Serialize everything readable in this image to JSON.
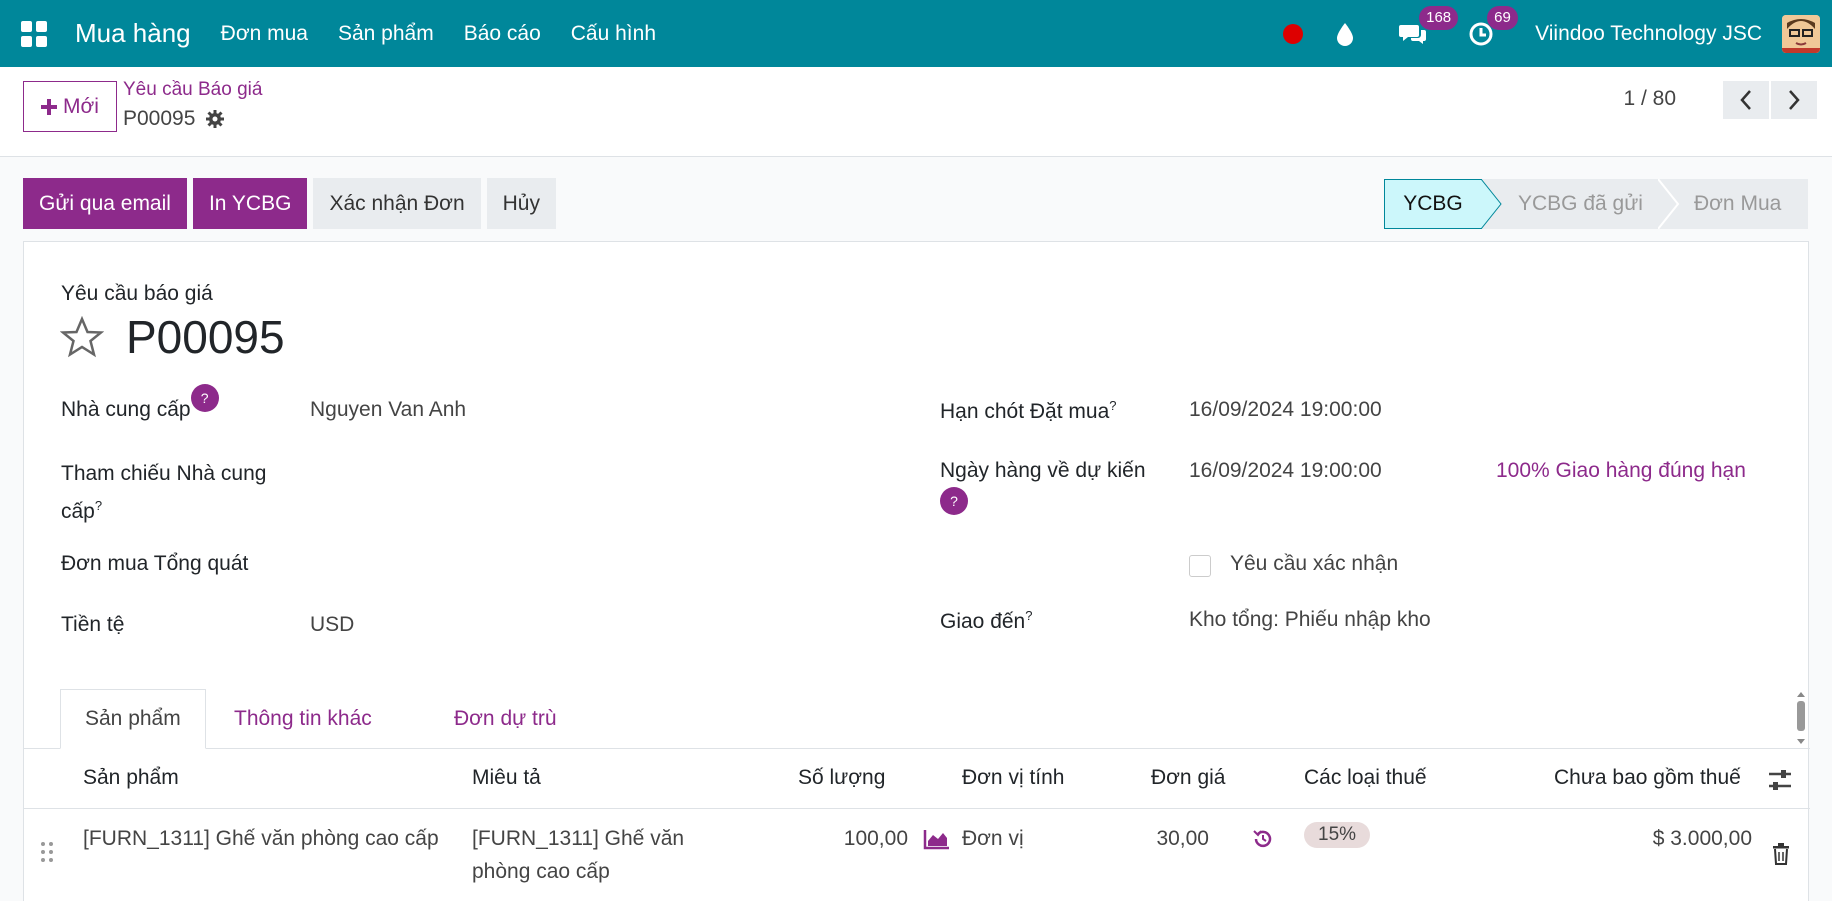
{
  "navbar": {
    "app_title": "Mua hàng",
    "menu": [
      "Đơn mua",
      "Sản phẩm",
      "Báo cáo",
      "Cấu hình"
    ],
    "messages_count": "168",
    "activities_count": "69",
    "company": "Viindoo Technology JSC",
    "icons": [
      "apps-grid-icon",
      "record-dot-icon",
      "drop-icon",
      "chat-icon",
      "clock-icon",
      "avatar"
    ]
  },
  "control": {
    "new_label": "Mới",
    "breadcrumb_parent": "Yêu cầu Báo giá",
    "breadcrumb_current": "P00095",
    "pager": "1 / 80"
  },
  "actions": {
    "send_email": "Gửi qua email",
    "print_rfq": "In YCBG",
    "confirm_order": "Xác nhận Đơn",
    "cancel": "Hủy"
  },
  "status": {
    "stages": [
      "YCBG",
      "YCBG đã gửi",
      "Đơn Mua"
    ],
    "active": "YCBG"
  },
  "form": {
    "top_label": "Yêu cầu báo giá",
    "record_name": "P00095",
    "vendor_label": "Nhà cung cấp",
    "vendor_value": "Nguyen Van Anh",
    "vendor_ref_label_1": "Tham chiếu Nhà cung",
    "vendor_ref_label_2": "cấp",
    "blanket_label": "Đơn mua Tổng quát",
    "currency_label": "Tiền tệ",
    "currency_value": "USD",
    "deadline_label": "Hạn chót Đặt mua",
    "deadline_value": "16/09/2024 19:00:00",
    "expected_label": "Ngày hàng về dự kiến",
    "expected_value": "16/09/2024 19:00:00",
    "on_time": "100% Giao hàng đúng hạn",
    "ask_confirm_label": "Yêu cầu xác nhận",
    "deliver_to_label": "Giao đến",
    "deliver_to_value": "Kho tổng: Phiếu nhập kho"
  },
  "tabs": [
    "Sản phẩm",
    "Thông tin khác",
    "Đơn dự trù"
  ],
  "table": {
    "headers": [
      "Sản phẩm",
      "Miêu tả",
      "Số lượng",
      "Đơn vị tính",
      "Đơn giá",
      "Các loại thuế",
      "Chưa bao gồm thuế"
    ],
    "rows": [
      {
        "product": "[FURN_1311] Ghế văn phòng cao cấp",
        "description_1": "[FURN_1311] Ghế văn",
        "description_2": "phòng cao cấp",
        "quantity": "100,00",
        "uom": "Đơn vị",
        "price": "30,00",
        "tax": "15%",
        "subtotal": "$ 3.000,00"
      }
    ]
  },
  "colors": {
    "navbar": "#00879a",
    "primary": "#8d2a8b",
    "stage_active": "#ccf7fb"
  }
}
